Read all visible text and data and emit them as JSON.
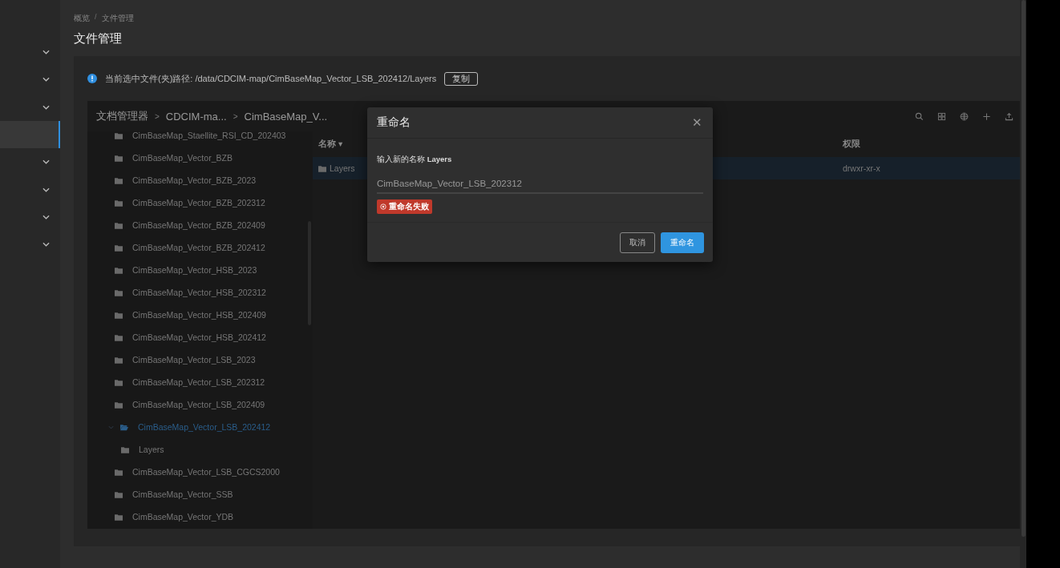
{
  "sidebar": {
    "items": [
      {
        "kind": "group",
        "selected": false
      },
      {
        "kind": "group",
        "selected": false
      },
      {
        "kind": "group",
        "selected": false
      },
      {
        "kind": "link",
        "selected": true
      },
      {
        "kind": "group",
        "selected": false
      },
      {
        "kind": "group",
        "selected": false
      },
      {
        "kind": "group",
        "selected": false
      },
      {
        "kind": "group",
        "selected": false
      }
    ]
  },
  "breadcrumb": [
    {
      "kind": "link",
      "text": "概览"
    },
    {
      "kind": "separator",
      "text": "/"
    },
    {
      "kind": "link",
      "text": "文件管理"
    }
  ],
  "page_title": "文件管理",
  "path_notice": {
    "text": "当前选中文件(夹)路径: /data/CDCIM-map/CimBaseMap_Vector_LSB_202412/Layers",
    "copy_button": "复制"
  },
  "file_manager": {
    "path": [
      {
        "kind": "link",
        "text": "文档管理器"
      },
      {
        "kind": "separator",
        "text": ">"
      },
      {
        "kind": "link",
        "text": "CDCIM-ma..."
      },
      {
        "kind": "separator",
        "text": ">"
      },
      {
        "kind": "link",
        "text": "CimBaseMap_V..."
      }
    ],
    "tree": [
      {
        "label": "CimBaseMap_Staellite_RSI_CD_202403",
        "expanded": false,
        "selected": false
      },
      {
        "label": "CimBaseMap_Vector_BZB",
        "expanded": false,
        "selected": false
      },
      {
        "label": "CimBaseMap_Vector_BZB_2023",
        "expanded": false,
        "selected": false
      },
      {
        "label": "CimBaseMap_Vector_BZB_202312",
        "expanded": false,
        "selected": false
      },
      {
        "label": "CimBaseMap_Vector_BZB_202409",
        "expanded": false,
        "selected": false
      },
      {
        "label": "CimBaseMap_Vector_BZB_202412",
        "expanded": false,
        "selected": false
      },
      {
        "label": "CimBaseMap_Vector_HSB_2023",
        "expanded": false,
        "selected": false
      },
      {
        "label": "CimBaseMap_Vector_HSB_202312",
        "expanded": false,
        "selected": false
      },
      {
        "label": "CimBaseMap_Vector_HSB_202409",
        "expanded": false,
        "selected": false
      },
      {
        "label": "CimBaseMap_Vector_HSB_202412",
        "expanded": false,
        "selected": false
      },
      {
        "label": "CimBaseMap_Vector_LSB_2023",
        "expanded": false,
        "selected": false
      },
      {
        "label": "CimBaseMap_Vector_LSB_202312",
        "expanded": false,
        "selected": false
      },
      {
        "label": "CimBaseMap_Vector_LSB_202409",
        "expanded": false,
        "selected": false
      },
      {
        "label": "CimBaseMap_Vector_LSB_202412",
        "expanded": true,
        "selected": true,
        "children": [
          {
            "label": "Layers",
            "expanded": false,
            "selected": false
          }
        ]
      },
      {
        "label": "CimBaseMap_Vector_LSB_CGCS2000",
        "expanded": false,
        "selected": false
      },
      {
        "label": "CimBaseMap_Vector_SSB",
        "expanded": false,
        "selected": false
      },
      {
        "label": "CimBaseMap_Vector_YDB",
        "expanded": false,
        "selected": false
      }
    ],
    "columns": [
      "名称 ▾",
      "权限"
    ],
    "rows": [
      {
        "name": "Layers",
        "permissions": "drwxr-xr-x",
        "selected": true
      }
    ]
  },
  "dialog": {
    "title": "重命名",
    "close": "✕",
    "prompt": "输入新的名称 **Layers**",
    "value": "CimBaseMap_Vector_LSB_202312",
    "error": "重命名失败",
    "buttons": [
      {
        "label": "取消",
        "kind": "secondary"
      },
      {
        "label": "重命名",
        "kind": "primary"
      }
    ]
  }
}
